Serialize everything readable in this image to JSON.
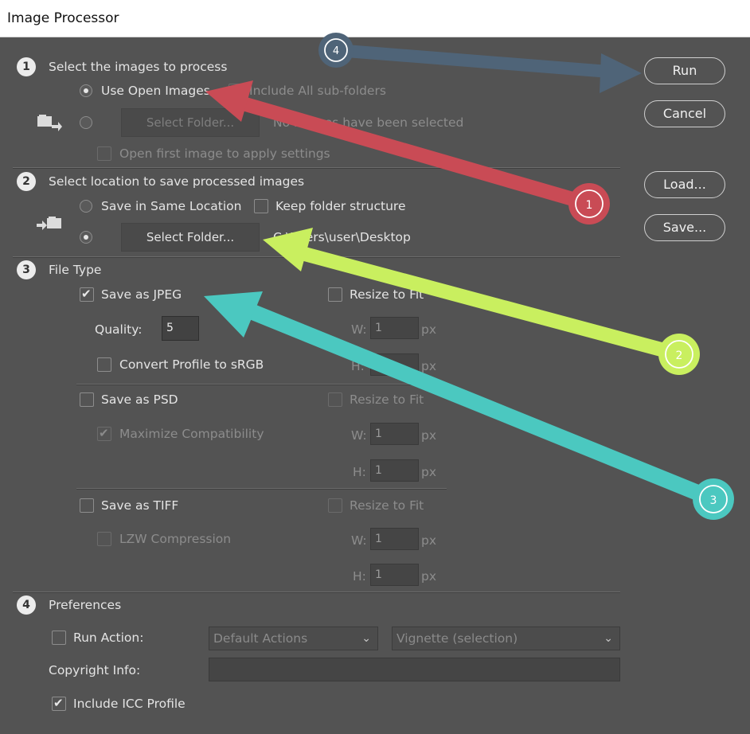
{
  "window": {
    "title": "Image Processor"
  },
  "section1": {
    "step": "1",
    "title": "Select the images to process",
    "use_open_images": "Use Open Images",
    "include_subfolders": "Include All sub-folders",
    "select_folder": "Select Folder...",
    "status": "No images have been selected",
    "open_first": "Open first image to apply settings"
  },
  "section2": {
    "step": "2",
    "title": "Select location to save processed images",
    "same_location": "Save in Same Location",
    "keep_structure": "Keep folder structure",
    "select_folder": "Select Folder...",
    "path": "C:\\Users\\user\\Desktop"
  },
  "section3": {
    "step": "3",
    "title": "File Type",
    "jpeg": {
      "label": "Save as JPEG",
      "resize": "Resize to Fit",
      "quality_label": "Quality:",
      "quality_value": "5",
      "convert": "Convert Profile to sRGB",
      "w_label": "W:",
      "h_label": "H:",
      "w_value": "1",
      "h_value": "1",
      "unit": "px"
    },
    "psd": {
      "label": "Save as PSD",
      "resize": "Resize to Fit",
      "maximize": "Maximize Compatibility",
      "w_label": "W:",
      "h_label": "H:",
      "w_value": "1",
      "h_value": "1",
      "unit": "px"
    },
    "tiff": {
      "label": "Save as TIFF",
      "resize": "Resize to Fit",
      "lzw": "LZW Compression",
      "w_label": "W:",
      "h_label": "H:",
      "w_value": "1",
      "h_value": "1",
      "unit": "px"
    }
  },
  "section4": {
    "step": "4",
    "title": "Preferences",
    "run_action": "Run Action:",
    "action_set": "Default Actions",
    "action": "Vignette (selection)",
    "copyright": "Copyright Info:",
    "copyright_value": "",
    "icc": "Include ICC Profile"
  },
  "buttons": {
    "run": "Run",
    "cancel": "Cancel",
    "load": "Load...",
    "save": "Save..."
  },
  "annotations": [
    {
      "label": "1",
      "color": "#c94b55"
    },
    {
      "label": "2",
      "color": "#c9ef5f"
    },
    {
      "label": "3",
      "color": "#4bc8c0"
    },
    {
      "label": "4",
      "color": "#4f6478"
    }
  ]
}
